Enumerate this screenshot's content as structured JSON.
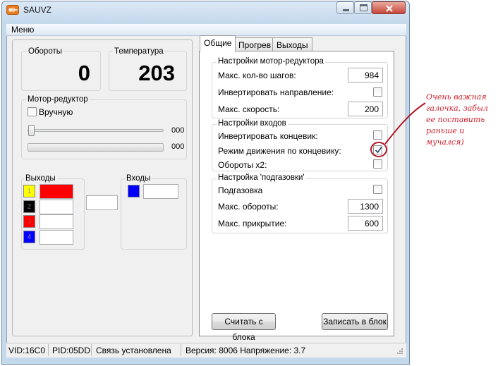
{
  "window": {
    "title": "SAUVZ"
  },
  "menu": {
    "items": [
      "Меню"
    ]
  },
  "left": {
    "rpm": {
      "label": "Обороты",
      "value": "0"
    },
    "temp": {
      "label": "Температура",
      "value": "203"
    },
    "motor": {
      "label": "Мотор-редуктор",
      "manual_label": "Вручную",
      "slider_value": "000",
      "progress_value": "000"
    },
    "outputs": {
      "label": "Выходы",
      "items": [
        {
          "num": "1",
          "color": "#ffff00",
          "value_color": "#ff0000"
        },
        {
          "num": "2",
          "color": "#000000",
          "value_color": "#ffffff"
        },
        {
          "num": "3",
          "color": "#ff0000",
          "value_color": "#ffffff"
        },
        {
          "num": "4",
          "color": "#0000ff",
          "value_color": "#ffffff"
        }
      ]
    },
    "inputs": {
      "label": "Входы",
      "color": "#0000ff"
    }
  },
  "tabs": [
    "Общие",
    "Прогрев",
    "Выходы"
  ],
  "general": {
    "motor_section": {
      "label": "Настройки мотор-редуктора",
      "max_steps_label": "Макс. кол-во шагов:",
      "max_steps_value": "984",
      "invert_dir_label": "Инвертировать направление:",
      "max_speed_label": "Макс. скорость:",
      "max_speed_value": "200"
    },
    "inputs_section": {
      "label": "Настройки входов",
      "invert_end_label": "Инвертировать концевик:",
      "end_mode_label": "Режим движения по концевику:",
      "end_mode_checked": true,
      "rpm_x2_label": "Обороты х2:"
    },
    "gas_section": {
      "label": "Настройка 'подгазовки'",
      "gas_label": "Подгазовка",
      "max_rpm_label": "Макс. обороты:",
      "max_rpm_value": "1300",
      "max_close_label": "Макс. прикрытие:",
      "max_close_value": "600"
    },
    "read_button": "Считать с блока",
    "write_button": "Записать в блок"
  },
  "status": {
    "vid": "VID:16C0",
    "pid": "PID:05DD",
    "link": "Связь установлена",
    "version": "Версия: 8006 Напряжение: 3.7"
  },
  "annotation": "Очень важная галочка, забыл ее поставить раньше и мучался)",
  "colors": {
    "annotation": "#d0202e",
    "accent_orange": "#e97c1f"
  }
}
